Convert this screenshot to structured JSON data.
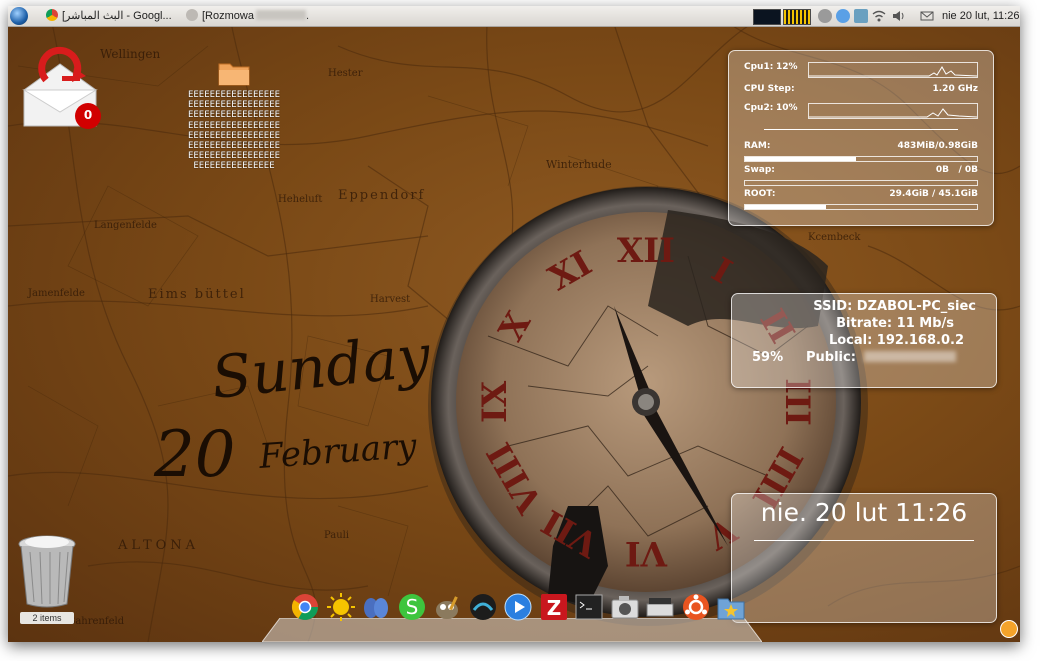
{
  "top_panel": {
    "tasks": [
      {
        "label": "[البث المباشر - Googl...",
        "icon": "chrome-icon"
      },
      {
        "label": "[Rozmowa",
        "trailing": ".",
        "icon": "pidgin-icon"
      }
    ],
    "clock": "nie 20 lut, 11:26"
  },
  "desktop": {
    "folder_label": "EEEEEEEEEEEEEEEEEEEEEEEEEEEEEEEEEEEEEEEEEEEEEEEEEEEEEEEEEEEEEEEEEEEEEEEEEEEEEEEEEEEEEEEEEEEEEEEEEEEEEEEEEEEEEEEEEEEEEEEEEEEEEEEEEEEEEE",
    "mail_badge": "0",
    "trash_label": "2 items"
  },
  "wallpaper": {
    "day": "Sunday",
    "date_number": "20",
    "month": "February",
    "clock_numerals": [
      "XII",
      "I",
      "II",
      "III",
      "IIII",
      "V",
      "VI",
      "VII",
      "VIII",
      "IX",
      "X",
      "XI"
    ],
    "map_labels": [
      "Hester",
      "Winterhude",
      "Eppendorf",
      "Heheluft",
      "Eims büttel",
      "Harvest",
      "Langenfelde",
      "Jamenfelde",
      "ALTONA",
      "Pauli",
      "Kcembeck",
      "Bahrenfeld",
      "Wellingen"
    ]
  },
  "system": {
    "cpu1_label": "Cpu1:",
    "cpu1_value": "12%",
    "cpu_step_label": "CPU Step:",
    "cpu_step_value": "1.20 GHz",
    "cpu2_label": "Cpu2:",
    "cpu2_value": "10%",
    "ram_label": "RAM:",
    "ram_value": "483MiB/0.98GiB",
    "ram_fraction": 0.48,
    "swap_label": "Swap:",
    "swap_value": "0B   / 0B",
    "swap_fraction": 0.0,
    "root_label": "ROOT:",
    "root_value": "29.4GiB / 45.1GiB",
    "root_fraction": 0.35
  },
  "network": {
    "ssid": "SSID: DZABOL-PC_siec",
    "bitrate": "Bitrate: 11 Mb/s",
    "local": "Local: 192.168.0.2",
    "public_label": "Public:",
    "signal": "59%"
  },
  "clock_widget": {
    "text": "nie. 20 lut 11:26"
  },
  "dock": {
    "icons": [
      "chrome-icon",
      "weather-icon",
      "pidgin-icon",
      "skype-icon",
      "gimp-icon",
      "terminal-network-icon",
      "media-player-icon",
      "filezilla-icon",
      "terminal-icon",
      "camera-icon",
      "scanner-icon",
      "ubuntu-icon",
      "folder-icon"
    ]
  },
  "colors": {
    "wallpaper": "#7a4916",
    "panel": "#e6e3df",
    "glass": "rgba(255,255,255,0.28)",
    "numeral": "#6e1a12"
  }
}
